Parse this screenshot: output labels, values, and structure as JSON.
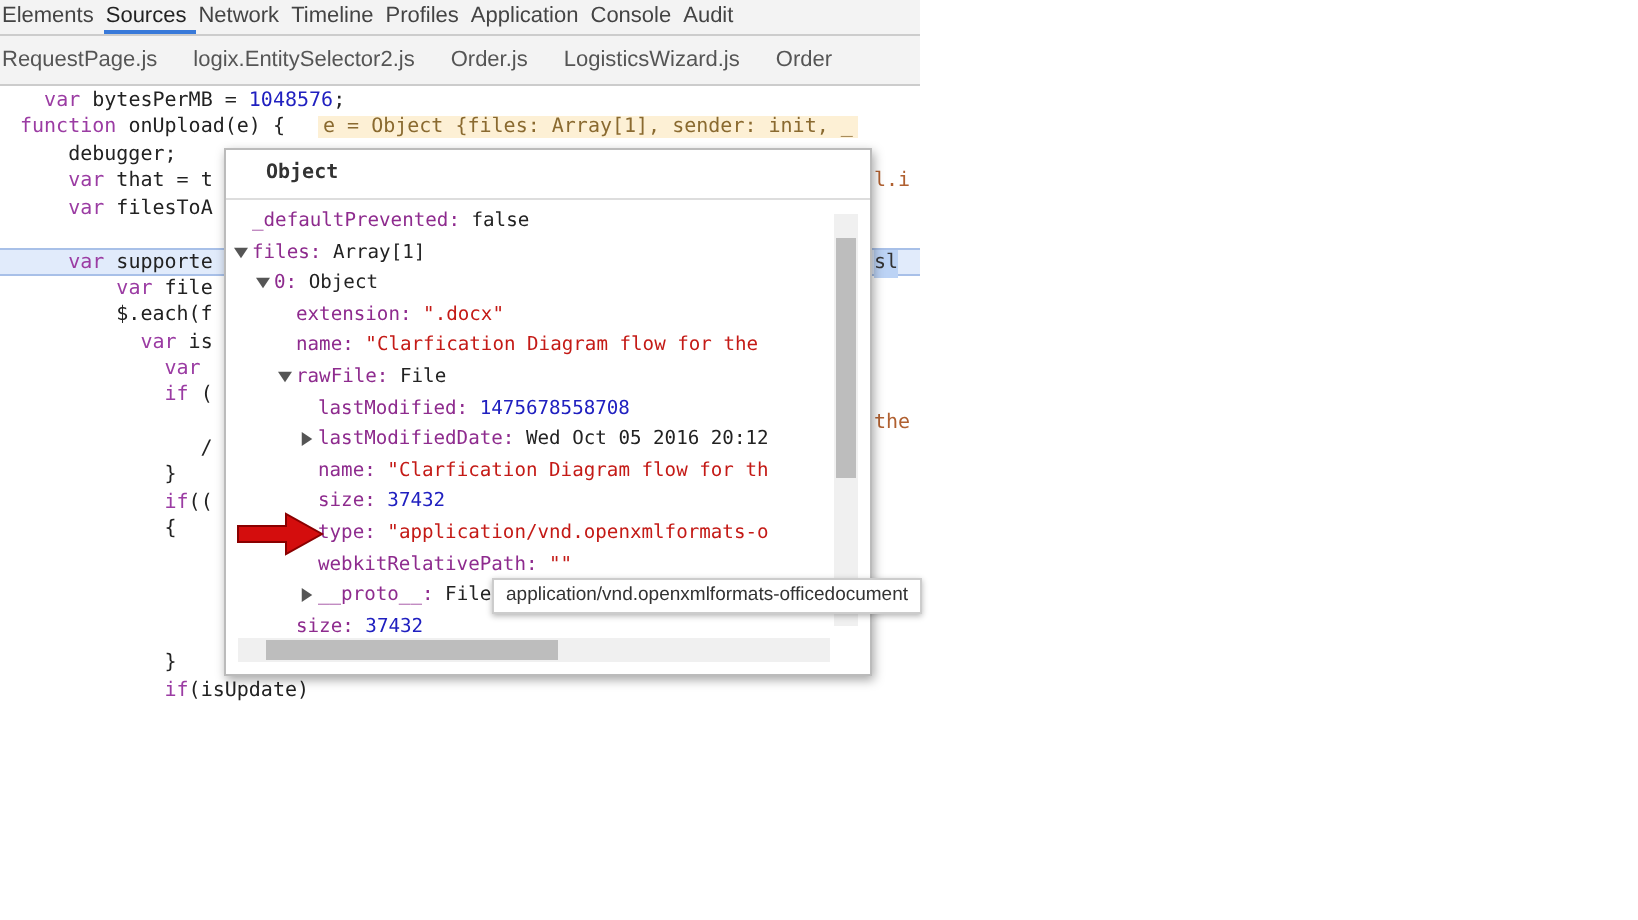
{
  "panel_tabs": [
    {
      "label": "Elements",
      "selected": false
    },
    {
      "label": "Sources",
      "selected": true
    },
    {
      "label": "Network",
      "selected": false
    },
    {
      "label": "Timeline",
      "selected": false
    },
    {
      "label": "Profiles",
      "selected": false
    },
    {
      "label": "Application",
      "selected": false
    },
    {
      "label": "Console",
      "selected": false
    },
    {
      "label": "Audit",
      "selected": false
    }
  ],
  "file_tabs": [
    "RequestPage.js",
    "logix.EntitySelector2.js",
    "Order.js",
    "LogisticsWizard.js",
    "Order"
  ],
  "code_lines": [
    {
      "text": "  var bytesPerMB = 1048576;",
      "current": false
    },
    {
      "text": "function onUpload(e) {",
      "inline_value": "e = Object {files: Array[1], sender: init, _",
      "current": false
    },
    {
      "text": "    debugger;",
      "current": false
    },
    {
      "text": "    var that = t",
      "tail": "l.i",
      "current": false
    },
    {
      "text": "    var filesToA",
      "current": false
    },
    {
      "current": false
    },
    {
      "text": "    var supporte",
      "tail": "sl",
      "current": true
    },
    {
      "text": "        var file",
      "current": false
    },
    {
      "text": "        $.each(f",
      "current": false
    },
    {
      "text": "          var is",
      "current": false
    },
    {
      "text": "            var",
      "current": false
    },
    {
      "text": "            if (",
      "current": false
    },
    {
      "tail": "the",
      "current": false
    },
    {
      "text": "               /",
      "current": false
    },
    {
      "text": "            }",
      "current": false
    },
    {
      "text": "            if((",
      "current": false
    },
    {
      "text": "            {",
      "current": false
    },
    {
      "current": false
    },
    {
      "current": false
    },
    {
      "current": false
    },
    {
      "current": false
    },
    {
      "text": "            }",
      "current": false
    },
    {
      "text": "            if(isUpdate)",
      "current": false
    }
  ],
  "popover": {
    "title": "Object",
    "rows": [
      {
        "key": "_defaultPrevented:",
        "value": "false",
        "kind": "plain"
      },
      {
        "key": "files:",
        "value": "Array[1]",
        "kind": "plain",
        "expanded": true,
        "children": [
          {
            "key": "0:",
            "value": "Object",
            "kind": "plain",
            "expanded": true,
            "children": [
              {
                "key": "extension:",
                "value": "\".docx\"",
                "kind": "string"
              },
              {
                "key": "name:",
                "value": "\"Clarfication Diagram flow for the",
                "kind": "string"
              },
              {
                "key": "rawFile:",
                "value": "File",
                "kind": "plain",
                "expanded": true,
                "children": [
                  {
                    "key": "lastModified:",
                    "value": "1475678558708",
                    "kind": "number"
                  },
                  {
                    "key": "lastModifiedDate:",
                    "value": "Wed Oct 05 2016 20:12",
                    "kind": "plain",
                    "expanded": false
                  },
                  {
                    "key": "name:",
                    "value": "\"Clarfication Diagram flow for th",
                    "kind": "string"
                  },
                  {
                    "key": "size:",
                    "value": "37432",
                    "kind": "number"
                  },
                  {
                    "key": "type:",
                    "value": "\"application/vnd.openxmlformats-o",
                    "kind": "string"
                  },
                  {
                    "key": "webkitRelativePath:",
                    "value": "\"\"",
                    "kind": "string"
                  },
                  {
                    "key": "__proto__:",
                    "value": "File",
                    "kind": "plain",
                    "expanded": false
                  }
                ]
              },
              {
                "key": "size:",
                "value": "37432",
                "kind": "number"
              }
            ]
          }
        ]
      }
    ]
  },
  "tooltip": "application/vnd.openxmlformats-officedocument"
}
